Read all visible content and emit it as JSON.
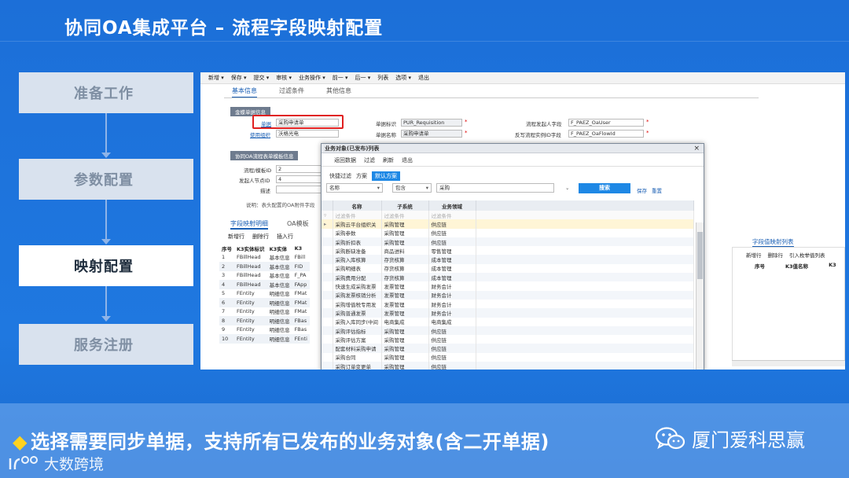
{
  "slide": {
    "title": "协同OA集成平台 – 流程字段映射配置",
    "steps": [
      "准备工作",
      "参数配置",
      "映射配置",
      "服务注册"
    ],
    "active_step": 2,
    "banner_text": "选择需要同步单据，支持所有已发布的业务对象(含二开单据)",
    "wechat_label": "厦门爱科思赢",
    "brand_label": "大数跨境"
  },
  "menubar": [
    "新增 ▾",
    "保存 ▾",
    "提交 ▾",
    "审核 ▾",
    "业务操作 ▾",
    "前一 ▾",
    "后一 ▾",
    "列表",
    "选项 ▾",
    "退出"
  ],
  "tabs": [
    "基本信息",
    "过滤条件",
    "其他信息"
  ],
  "form": {
    "section1": "金蝶单据信息",
    "bill_label": "单据",
    "bill_value": "采购申请单",
    "org_label": "使用组织",
    "org_value": "沃格光电",
    "bill_id_label": "单据标识",
    "bill_id_value": "PUR_Requisition",
    "bill_name_label": "单据名称",
    "bill_name_value": "采购申请单",
    "initiator_label": "流程发起人字段",
    "initiator_value": "F_PAEZ_OaUser",
    "writeback_label": "反写流程实例ID字段",
    "writeback_value": "F_PAEZ_OaFlowId",
    "section2": "协同OA流程表单模板信息",
    "template_label": "流程/模板ID",
    "template_value": "2",
    "node_label": "发起人节点ID",
    "node_value": "4",
    "desc_label": "描述",
    "note": "说明：表头配置的OA附件字段"
  },
  "subtabs": [
    "字段映射明细",
    "OA模板"
  ],
  "grid_tools": [
    "新增行",
    "删除行",
    "插入行"
  ],
  "grid": {
    "headers": [
      "序号",
      "K3实体标识",
      "K3实体",
      "K3"
    ],
    "rows": [
      [
        "1",
        "FBillHead",
        "基本信息",
        "FBill"
      ],
      [
        "2",
        "FBillHead",
        "基本信息",
        "FID"
      ],
      [
        "3",
        "FBillHead",
        "基本信息",
        "F_PA"
      ],
      [
        "4",
        "FBillHead",
        "基本信息",
        "FApp"
      ],
      [
        "5",
        "FEntity",
        "明细信息",
        "FMat"
      ],
      [
        "6",
        "FEntity",
        "明细信息",
        "FMat"
      ],
      [
        "7",
        "FEntity",
        "明细信息",
        "FMat"
      ],
      [
        "8",
        "FEntity",
        "明细信息",
        "FBas"
      ],
      [
        "9",
        "FEntity",
        "明细信息",
        "FBas"
      ],
      [
        "10",
        "FEntity",
        "明细信息",
        "FEnti"
      ]
    ]
  },
  "right_panel": {
    "title": "字段值映射列表",
    "tools": [
      "新增行",
      "删除行",
      "引入枚举值列表"
    ],
    "headers": [
      "序号",
      "K3值名称",
      "K3"
    ]
  },
  "dialog": {
    "title": "业务对象(已发布)列表",
    "close": "×",
    "tools": [
      "返回数据",
      "过滤",
      "刷新",
      "退出"
    ],
    "quick_filter": "快捷过滤",
    "scheme": "方案",
    "default_scheme": "默认方案",
    "field_select": "名称",
    "op_select": "包含",
    "keyword": "采购",
    "search_btn": "搜索",
    "save": "保存",
    "reset": "重置",
    "headers": [
      "名称",
      "子系统",
      "业务领域"
    ],
    "filter_row": [
      "过滤条件",
      "过滤条件",
      "过滤条件"
    ],
    "rows": [
      [
        "采购云平台组织关",
        "采购管理",
        "供应链"
      ],
      [
        "采购参数",
        "采购管理",
        "供应链"
      ],
      [
        "采购折扣表",
        "采购管理",
        "供应链"
      ],
      [
        "采购断缺准备",
        "商品进料",
        "零售管理"
      ],
      [
        "采购入库核算",
        "存货核算",
        "成本管理"
      ],
      [
        "采购明细表",
        "存货核算",
        "成本管理"
      ],
      [
        "采购费用分配",
        "存货核算",
        "成本管理"
      ],
      [
        "快速生成采购发票",
        "发票管理",
        "财务会计"
      ],
      [
        "采购发票核销分析",
        "发票管理",
        "财务会计"
      ],
      [
        "采购增值税专用发",
        "发票管理",
        "财务会计"
      ],
      [
        "采购普通发票",
        "发票管理",
        "财务会计"
      ],
      [
        "采购入库同步(中间",
        "电商集成",
        "电商集成"
      ],
      [
        "采购评估指标",
        "采购管理",
        "供应链"
      ],
      [
        "采购评估方案",
        "采购管理",
        "供应链"
      ],
      [
        "配套材料采购申请",
        "采购管理",
        "供应链"
      ],
      [
        "采购合同",
        "采购管理",
        "供应链"
      ],
      [
        "采购订单变更单",
        "采购管理",
        "供应链"
      ]
    ]
  },
  "colors": {
    "accent": "#1a5fb4",
    "highlight": "#e02020",
    "slide_bg": "#1c6fd8",
    "bullet": "#ffd21f"
  }
}
